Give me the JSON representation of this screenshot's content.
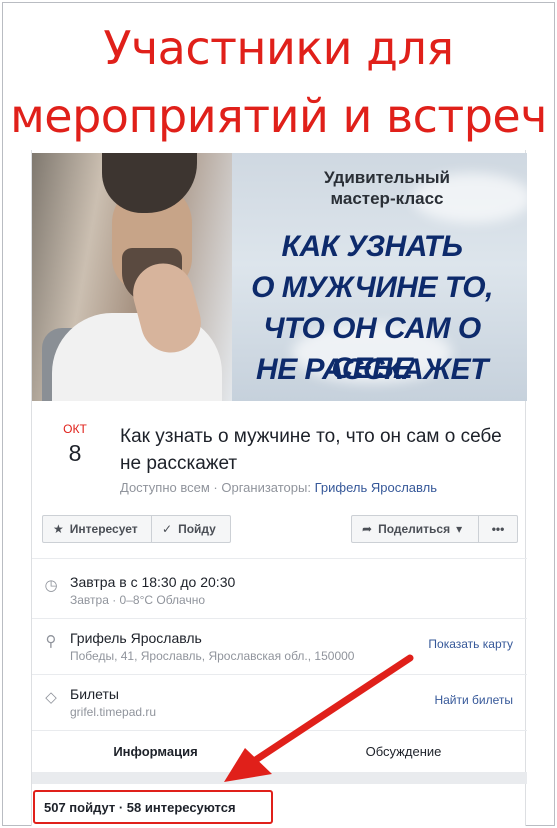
{
  "headline": {
    "line1": "Участники для",
    "line2": "мероприятий и встреч"
  },
  "banner": {
    "subtitle_line1": "Удивительный",
    "subtitle_line2": "мастер-класс",
    "main_line1": "КАК УЗНАТЬ",
    "main_line2": "О МУЖЧИНЕ ТО,",
    "main_line3": "ЧТО ОН САМ О СЕБЕ",
    "main_line4": "НЕ РАССКАЖЕТ"
  },
  "event": {
    "month": "ОКТ",
    "day": "8",
    "title": "Как узнать о мужчине то, что он сам о себе не расскажет",
    "visibility": "Доступно всем",
    "organizers_label": "Организаторы:",
    "organizer": "Грифель Ярославль"
  },
  "buttons": {
    "interested": "Интересует",
    "going": "Пойду",
    "share": "Поделиться",
    "more": "•••"
  },
  "details": {
    "time_main": "Завтра в с 18:30 до 20:30",
    "time_sub": "Завтра · 0–8°C Облачно",
    "place_main": "Грифель Ярославль",
    "place_sub": "Победы, 41, Ярославль, Ярославская обл., 150000",
    "place_action": "Показать карту",
    "tickets_main": "Билеты",
    "tickets_sub": "grifel.timepad.ru",
    "tickets_action": "Найти билеты"
  },
  "tabs": {
    "info": "Информация",
    "discussion": "Обсуждение"
  },
  "stats": "507 пойдут · 58 интересуются",
  "colors": {
    "accent_red": "#e0201a",
    "link_blue": "#365899",
    "tab_blue": "#4267b2"
  }
}
